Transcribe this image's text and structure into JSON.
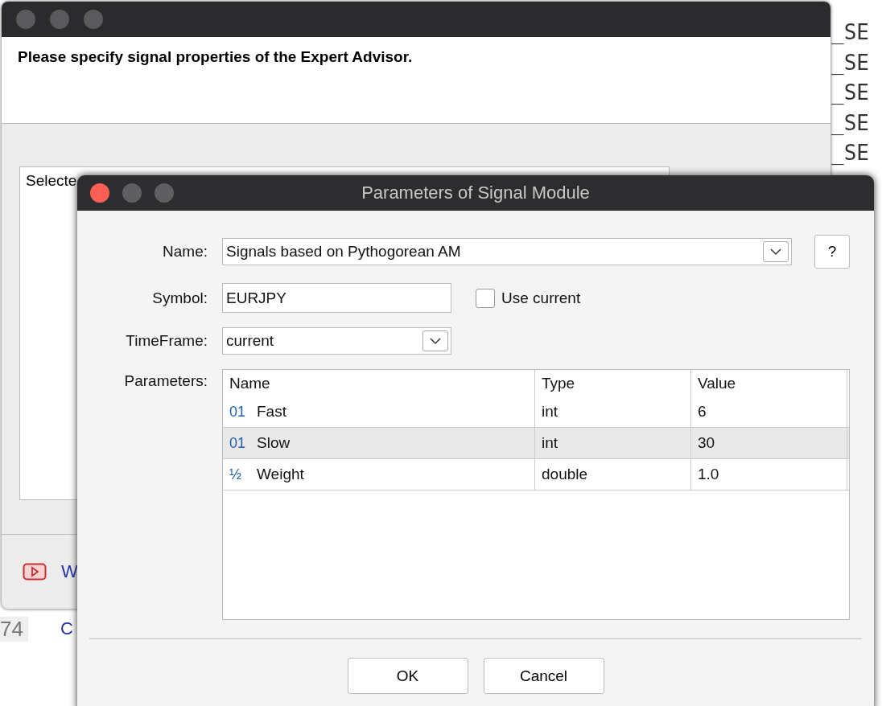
{
  "background_editor": {
    "lines": [
      "_SE",
      "_SE",
      "_SE",
      "_SE",
      "_SE"
    ],
    "line_number": "74",
    "link_fragment": "C"
  },
  "wizard_window": {
    "heading": "Please specify signal properties of the Expert Advisor.",
    "table_header": "Selecte",
    "link_fragment": "W"
  },
  "dialog": {
    "title": "Parameters of Signal Module",
    "fields": [
      {
        "kind": "combo",
        "label": "Name:",
        "value": "Signals based on Pythogorean AM"
      },
      {
        "kind": "text",
        "label": "Symbol:",
        "value": "EURJPY",
        "checkbox": {
          "label": "Use current",
          "checked": false
        }
      },
      {
        "kind": "combo",
        "label": "TimeFrame:",
        "value": "current"
      }
    ],
    "help_button": "?",
    "parameters_label": "Parameters:",
    "table": {
      "columns": [
        "Name",
        "Type",
        "Value"
      ],
      "rows": [
        {
          "type_icon": "01",
          "name": "Fast",
          "type": "int",
          "value": "6",
          "selected": false
        },
        {
          "type_icon": "01",
          "name": "Slow",
          "type": "int",
          "value": "30",
          "selected": true
        },
        {
          "type_icon": "½",
          "name": "Weight",
          "type": "double",
          "value": "1.0",
          "selected": false
        }
      ]
    },
    "buttons": [
      "OK",
      "Cancel"
    ]
  }
}
